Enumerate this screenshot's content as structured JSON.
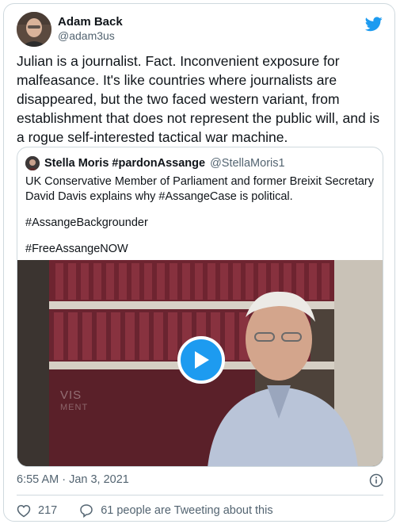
{
  "author": {
    "name": "Adam Back",
    "handle": "@adam3us"
  },
  "tweet": {
    "text": "Julian is a journalist. Fact. Inconvenient exposure for malfeasance. It's like countries where journalists are disappeared, but the two faced western variant, from establishment that does not represent the public will, and is a rogue self-interested tactical war machine."
  },
  "quoted": {
    "name": "Stella Moris #pardonAssange",
    "handle": "@StellaMoris1",
    "lines": [
      "UK Conservative Member of Parliament and former Breixit Secretary David Davis explains why #AssangeCase is political.",
      "#AssangeBackgrounder",
      "#FreeAssangeNOW"
    ],
    "video_overlay": [
      "VIS",
      "MENT"
    ]
  },
  "timestamp": "6:55 AM · Jan 3, 2021",
  "actions": {
    "likes": "217",
    "tweeting": "61 people are Tweeting about this"
  },
  "colors": {
    "accent": "#1d9bf0",
    "text": "#0f1419",
    "muted": "#536471",
    "border": "#cfd9de",
    "like": "#536471"
  },
  "icons": {
    "brand": "twitter-bird-icon",
    "info": "info-icon",
    "like": "heart-icon",
    "reply": "speech-bubble-icon",
    "play": "play-icon"
  }
}
